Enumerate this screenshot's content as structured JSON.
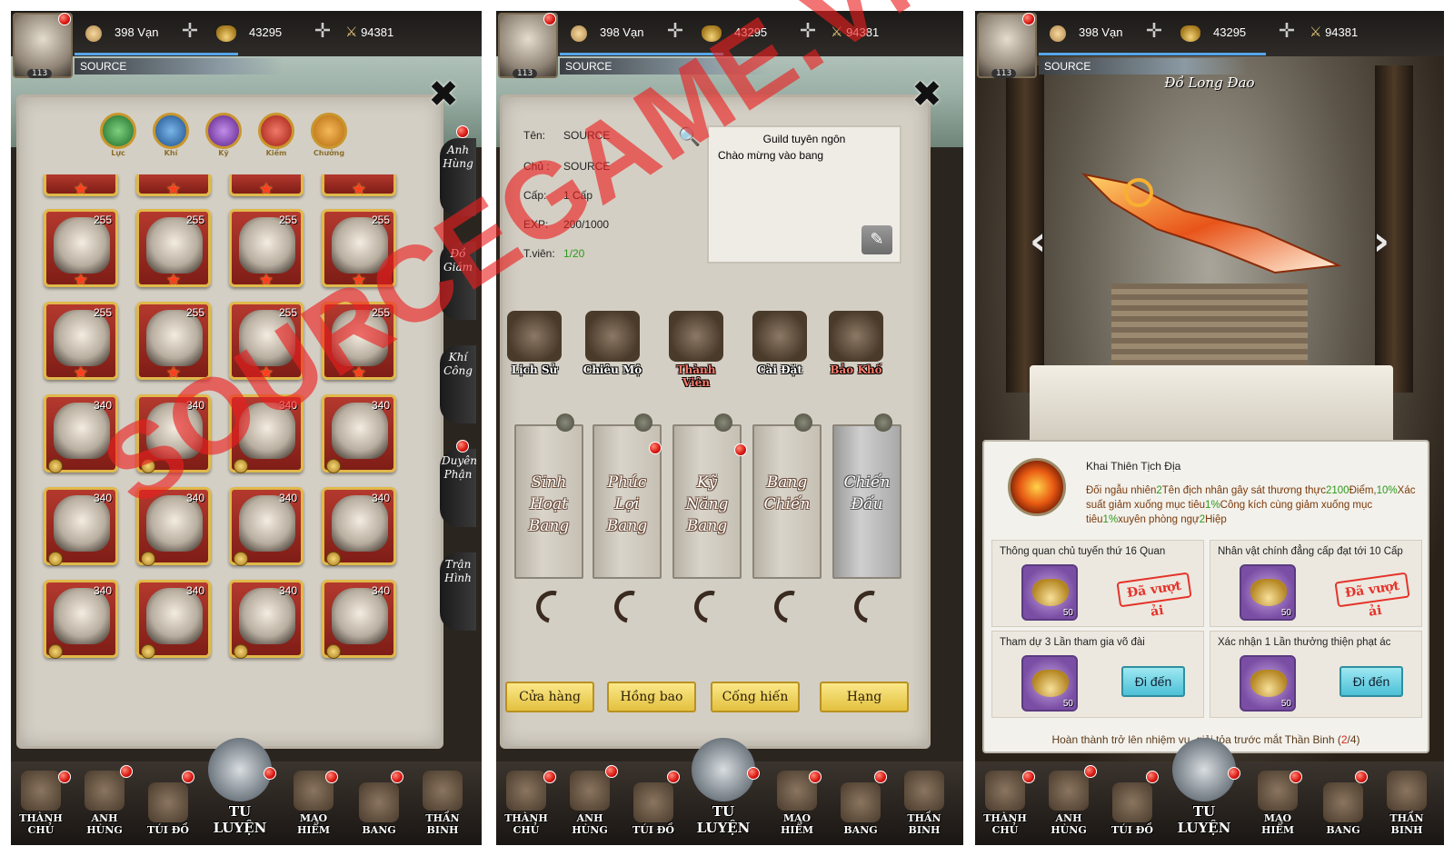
{
  "topbar": {
    "currency_silver": "398 Vạn",
    "currency_gold": "43295",
    "power": "94381",
    "player_level": "113",
    "player_name": "SOURCE"
  },
  "panel1": {
    "elements": [
      "Lực",
      "Khí",
      "Kỹ",
      "Kiếm",
      "Chưởng"
    ],
    "card_levels": [
      "255",
      "255",
      "255",
      "255",
      "255",
      "255",
      "255",
      "255",
      "340",
      "340",
      "340",
      "340",
      "340",
      "340",
      "340",
      "340",
      "340",
      "340",
      "340",
      "340"
    ],
    "side_tabs": [
      "Anh Hùng",
      "Đồ Giám",
      "Khí Công",
      "Duyên Phận",
      "Trận Hình"
    ]
  },
  "panel2": {
    "info": {
      "name_label": "Tên:",
      "name_value": "SOURCE",
      "owner_label": "Chủ :",
      "owner_value": "SOURCE",
      "level_label": "Cấp:",
      "level_value": "1 Cấp",
      "exp_label": "EXP:",
      "exp_value": "200/1000",
      "members_label": "T.viên:",
      "members_value": "1/20"
    },
    "guild_box": {
      "title": "Guild tuyên ngôn",
      "text": "Chào mừng vào bang"
    },
    "guild_icons": [
      "Lịch Sử",
      "Chiêu Mộ",
      "Thành Viên",
      "Cài Đặt",
      "Bảo Khố"
    ],
    "scrolls": [
      "Sinh Hoạt Bang",
      "Phúc Lợi Bang",
      "Kỹ Năng Bang",
      "Bang Chiến",
      "Chiến Đấu"
    ],
    "buttons": [
      "Cửa hàng",
      "Hồng bao",
      "Cống hiến",
      "Hạng"
    ]
  },
  "panel3": {
    "weapon_title": "Đồ Long Đao",
    "skill_title": "Khai Thiên Tịch Địa",
    "skill_desc": {
      "p1": "Đối ngẫu nhiên",
      "n1": "2",
      "p2": "Tên địch nhân gây sát thương thực",
      "n2": "2100",
      "p3": "Điểm,",
      "n3": "10%",
      "p4": "Xác suất giảm xuống mục tiêu",
      "n4": "1%",
      "p5": "Công kích cùng giảm xuống mục tiêu",
      "n5": "1%",
      "p6": "xuyên phòng ngự",
      "n6": "2",
      "p7": "Hiệp"
    },
    "quests": [
      {
        "title": "Thông quan chủ tuyến thứ 16 Quan",
        "count": "50",
        "status": "Đã vượt ải"
      },
      {
        "title": "Nhân vật chính đẳng cấp đạt tới 10 Cấp",
        "count": "50",
        "status": "Đã vượt ải"
      },
      {
        "title": "Tham dự 3 Lần tham gia võ đài",
        "count": "50",
        "action": "Đi đến"
      },
      {
        "title": "Xác nhận 1 Lần thưởng thiện phạt ác",
        "count": "50",
        "action": "Đi đến"
      }
    ],
    "progress": {
      "text": "Hoàn thành trở lên nhiệm vụ, giải tỏa trước mắt Thần Binh (",
      "done": "2",
      "total": "/4)"
    }
  },
  "bottom_nav": [
    "THÀNH CHỦ",
    "ANH HÙNG",
    "TÚI ĐỒ",
    "TU LUYỆN",
    "MẠO HIỂM",
    "BANG",
    "THẦN BINH"
  ],
  "watermark": "SOURCEGAME.VN",
  "colors": {
    "accent_red": "#d8150f",
    "gold": "#e3c13f",
    "highlight_green": "#2c9a1a",
    "cyan_button": "#4cc0d6"
  }
}
